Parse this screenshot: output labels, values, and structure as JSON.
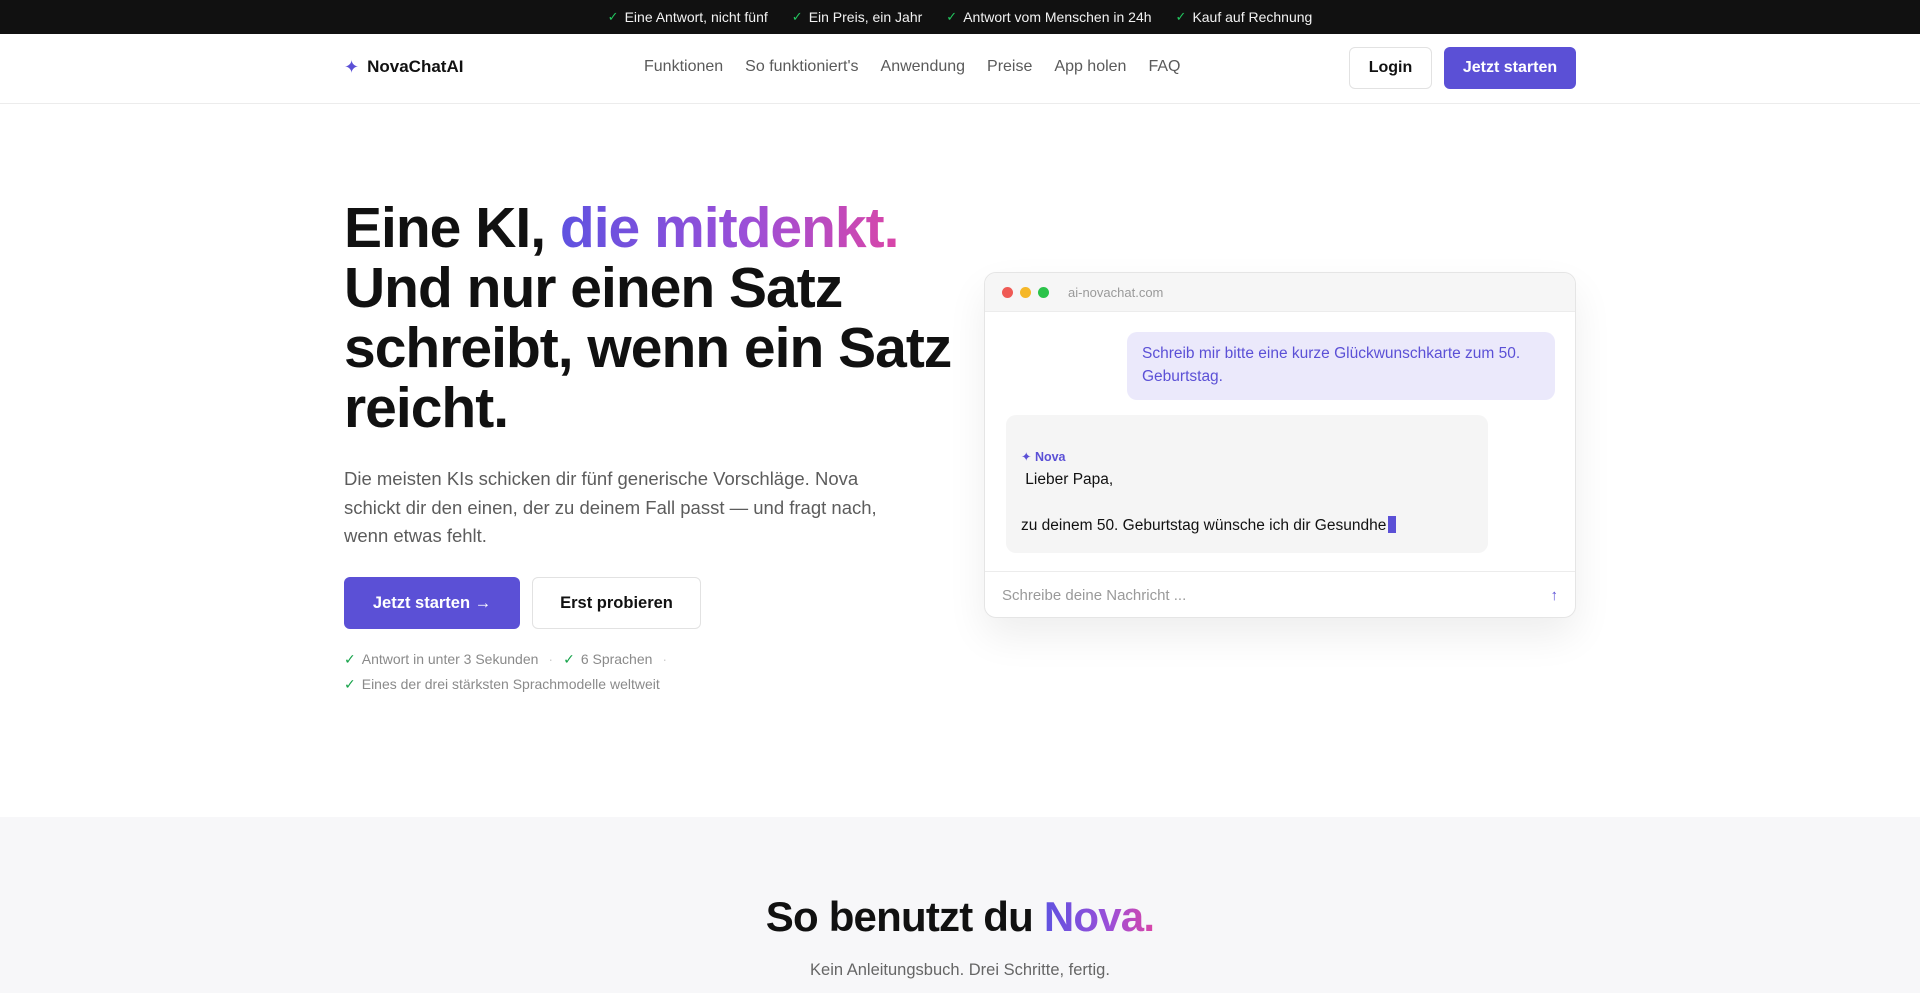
{
  "topbar": {
    "items": [
      "Eine Antwort, nicht fünf",
      "Ein Preis, ein Jahr",
      "Antwort vom Menschen in 24h",
      "Kauf auf Rechnung"
    ]
  },
  "header": {
    "logo_icon": "sparkle-icon",
    "logo_text": "NovaChatAI",
    "nav": [
      "Funktionen",
      "So funktioniert's",
      "Anwendung",
      "Preise",
      "App holen",
      "FAQ"
    ],
    "login_label": "Login",
    "start_label": "Jetzt starten"
  },
  "hero": {
    "title_part1": "Eine KI, ",
    "title_highlight": "die mitdenkt.",
    "title_part2": "Und nur einen Satz schreibt, wenn ein Satz reicht.",
    "subtitle": "Die meisten KIs schicken dir fünf generische Vorschläge. Nova schickt dir den einen, der zu deinem Fall passt — und fragt nach, wenn etwas fehlt.",
    "primary_button": "Jetzt starten →",
    "secondary_button": "Erst probieren",
    "features_row1": [
      "Antwort in unter 3 Sekunden",
      "6 Sprachen"
    ],
    "features_row2": [
      "Eines der drei stärksten Sprachmodelle weltweit"
    ],
    "separator": "·"
  },
  "chat": {
    "url": "ai-novachat.com",
    "user_message": "Schreib mir bitte eine kurze Glückwunschkarte zum 50. Geburtstag.",
    "bot_name": "✦ Nova",
    "bot_line1": " Lieber Papa,",
    "bot_line2": "zu deinem 50. Geburtstag wünsche ich dir Gesundhe",
    "input_placeholder": "Schreibe deine Nachricht ...",
    "send_icon": "↑"
  },
  "section2": {
    "title_part1": "So benutzt du ",
    "title_highlight": "Nova.",
    "subtitle": "Kein Anleitungsbuch. Drei Schritte, fertig."
  },
  "colors": {
    "accent": "#5b50d6",
    "topbar_bg": "#111111",
    "check_green": "#22c55e"
  }
}
